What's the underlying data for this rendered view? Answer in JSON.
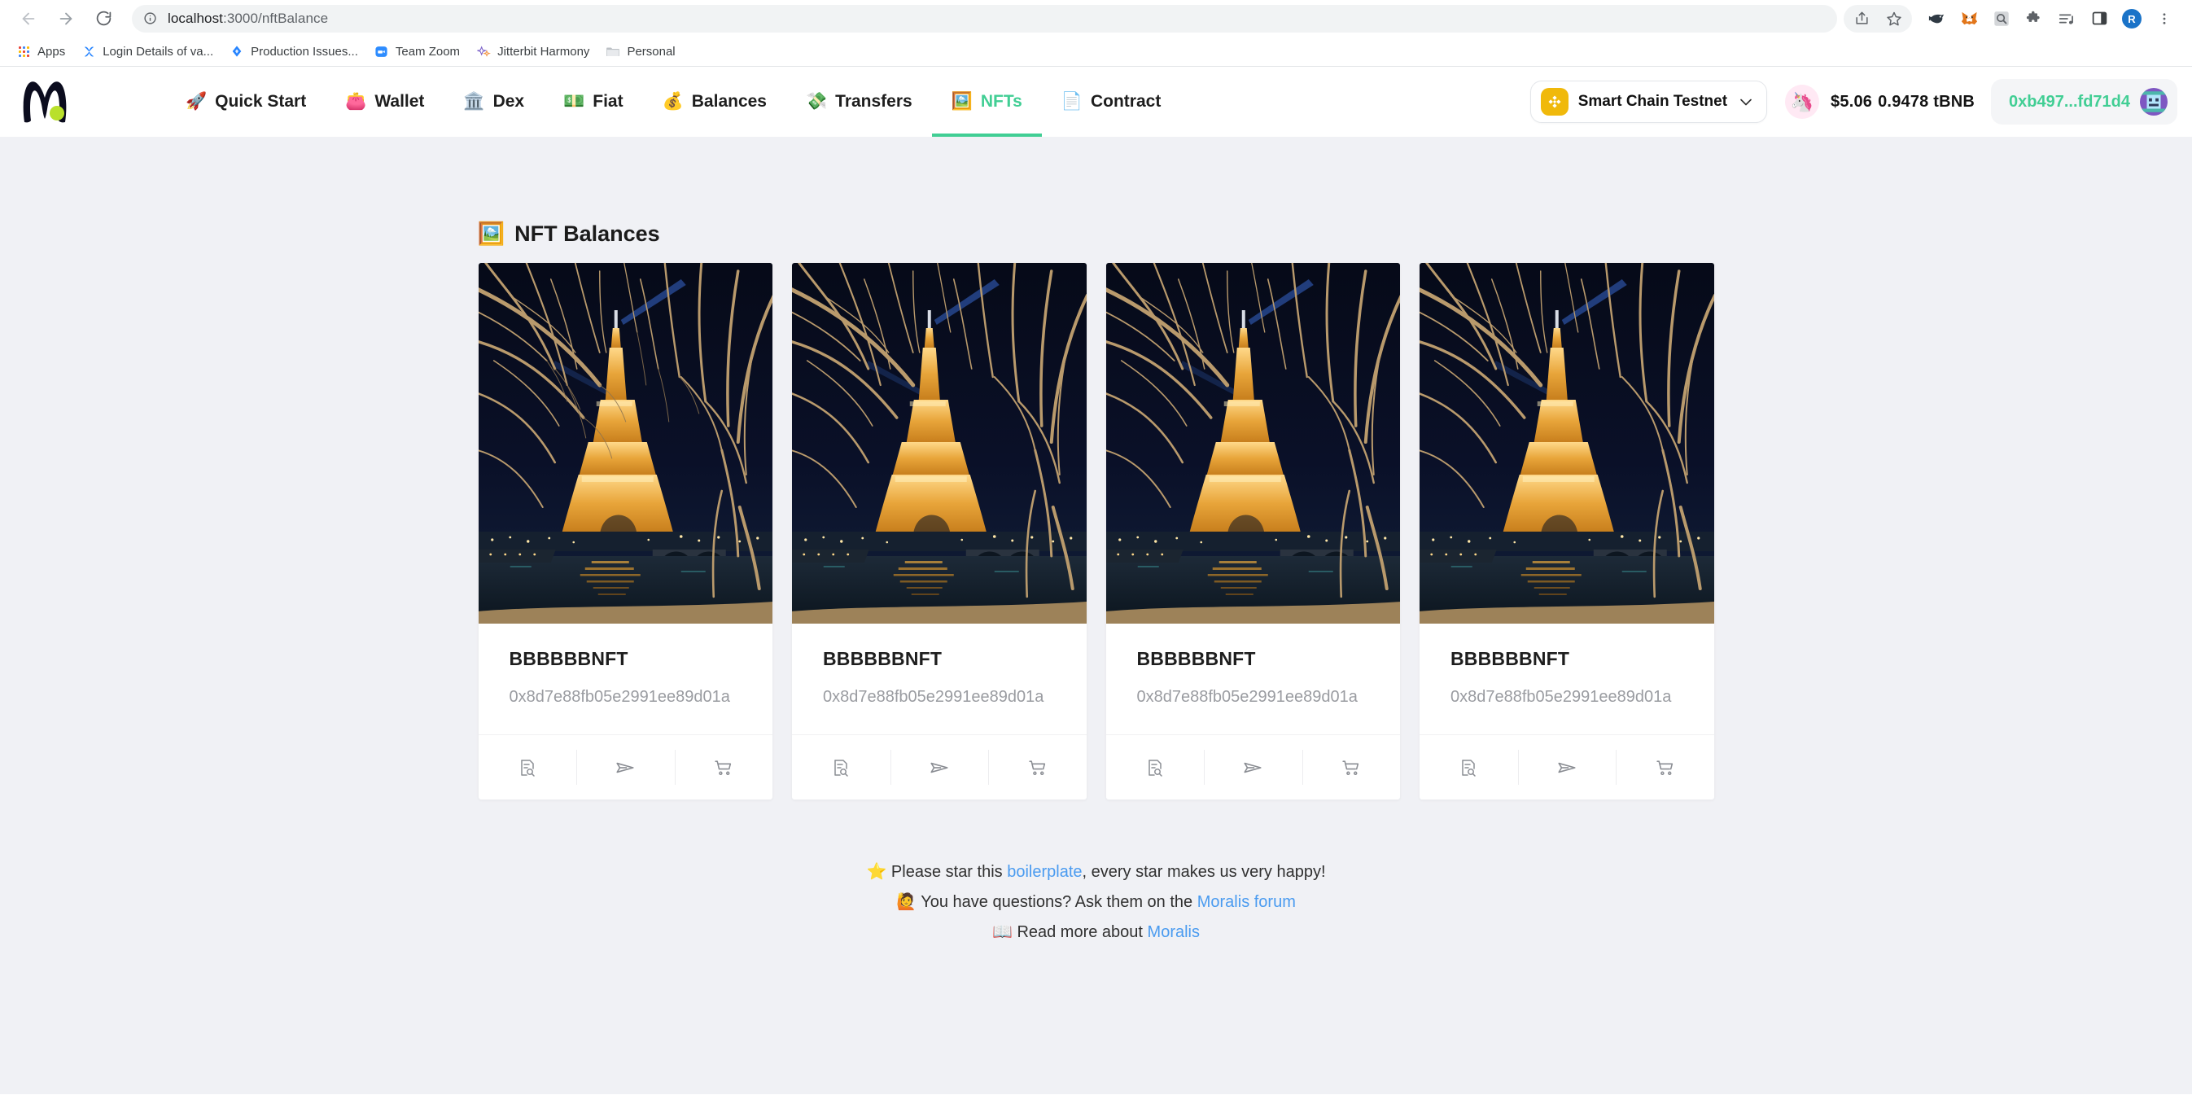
{
  "browser": {
    "url_host": "localhost",
    "url_path": ":3000/nftBalance",
    "back_icon": "back-arrow-icon",
    "forward_icon": "forward-arrow-icon",
    "reload_icon": "reload-icon",
    "info_icon": "site-info-icon",
    "toolbar_icons": [
      "share-icon",
      "bookmark-star-icon",
      "ethereum-wallet-extension-icon",
      "metamask-extension-icon",
      "search-extension-icon",
      "extensions-puzzle-icon",
      "reading-list-icon",
      "side-panel-icon",
      "profile-avatar-icon",
      "chrome-menu-icon"
    ],
    "profile_initial": "R",
    "bookmarks": [
      {
        "label": "Apps",
        "icon": "apps-grid-icon"
      },
      {
        "label": "Login Details of va...",
        "icon": "confluence-x-icon"
      },
      {
        "label": "Production Issues...",
        "icon": "jira-diamond-icon"
      },
      {
        "label": "Team Zoom",
        "icon": "zoom-camera-icon"
      },
      {
        "label": "Jitterbit Harmony",
        "icon": "jitterbit-star-icon"
      },
      {
        "label": "Personal",
        "icon": "folder-icon"
      }
    ]
  },
  "appbar": {
    "logo": "moralis-logo",
    "nav": [
      {
        "label": "Quick Start",
        "emoji": "🚀",
        "icon": "rocket-icon",
        "active": false
      },
      {
        "label": "Wallet",
        "emoji": "👛",
        "icon": "purse-icon",
        "active": false
      },
      {
        "label": "Dex",
        "emoji": "🏛️",
        "icon": "bank-icon",
        "active": false
      },
      {
        "label": "Fiat",
        "emoji": "💵",
        "icon": "banknote-icon",
        "active": false
      },
      {
        "label": "Balances",
        "emoji": "💰",
        "icon": "money-bag-icon",
        "active": false
      },
      {
        "label": "Transfers",
        "emoji": "💸",
        "icon": "flying-money-icon",
        "active": false
      },
      {
        "label": "NFTs",
        "emoji": "🖼️",
        "icon": "framed-picture-icon",
        "active": true
      },
      {
        "label": "Contract",
        "emoji": "📄",
        "icon": "page-icon",
        "active": false
      }
    ],
    "chain": {
      "name": "Smart Chain Testnet",
      "icon": "binance-chain-icon",
      "chevron": "∨",
      "color": "#F0B90B"
    },
    "balance": {
      "emoji": "🦄",
      "icon": "unicorn-icon",
      "usd": "$5.06",
      "native": "0.9478 tBNB"
    },
    "account": {
      "address": "0xb497...fd71d4",
      "avatar": "blockies-avatar",
      "color": "#41CE94"
    }
  },
  "main": {
    "panel_title": "NFT Balances",
    "panel_title_emoji": "🖼️",
    "panel_title_icon": "framed-picture-icon",
    "cards": [
      {
        "name": "BBBBBBNFT",
        "address": "0x8d7e88fb05e2991ee89d01a",
        "image_alt": "eiffel-tower-night-photo"
      },
      {
        "name": "BBBBBBNFT",
        "address": "0x8d7e88fb05e2991ee89d01a",
        "image_alt": "eiffel-tower-night-photo"
      },
      {
        "name": "BBBBBBNFT",
        "address": "0x8d7e88fb05e2991ee89d01a",
        "image_alt": "eiffel-tower-night-photo"
      },
      {
        "name": "BBBBBBNFT",
        "address": "0x8d7e88fb05e2991ee89d01a",
        "image_alt": "eiffel-tower-night-photo"
      }
    ],
    "card_actions": [
      {
        "icon": "metadata-search-icon",
        "name": "view-metadata-button"
      },
      {
        "icon": "send-plane-icon",
        "name": "transfer-nft-button"
      },
      {
        "icon": "shopping-cart-icon",
        "name": "sell-nft-button"
      }
    ]
  },
  "footer": {
    "line1_emoji": "⭐",
    "line1_pre": "Please star this ",
    "line1_link": "boilerplate",
    "line1_post": ", every star makes us very happy!",
    "line2_emoji": "🙋",
    "line2_pre": "You have questions? Ask them on the ",
    "line2_link": "Moralis forum",
    "line3_emoji": "📖",
    "line3_pre": "Read more about ",
    "line3_link": "Moralis"
  }
}
